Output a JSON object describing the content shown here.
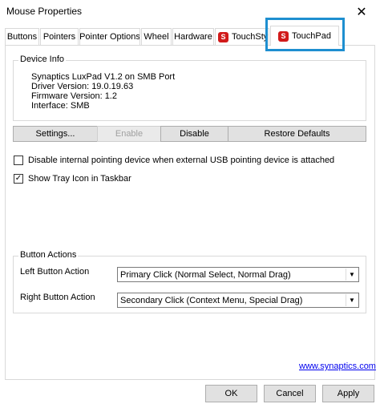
{
  "window": {
    "title": "Mouse Properties",
    "close_glyph": "✕"
  },
  "tabs": [
    {
      "label": "Buttons"
    },
    {
      "label": "Pointers"
    },
    {
      "label": "Pointer Options"
    },
    {
      "label": "Wheel"
    },
    {
      "label": "Hardware"
    },
    {
      "label": "TouchStyk"
    },
    {
      "label": "TouchPad",
      "active": true
    }
  ],
  "device_info": {
    "group_label": "Device Info",
    "lines": [
      "Synaptics LuxPad V1.2 on SMB Port",
      "Driver Version: 19.0.19.63",
      "Firmware Version: 1.2",
      "Interface: SMB"
    ]
  },
  "buttons": {
    "settings": "Settings...",
    "enable": "Enable",
    "disable": "Disable",
    "restore": "Restore Defaults"
  },
  "checkboxes": [
    {
      "label": "Disable internal pointing device when external USB pointing device is attached",
      "checked": false
    },
    {
      "label": "Show Tray Icon in Taskbar",
      "checked": true
    }
  ],
  "button_actions": {
    "group_label": "Button Actions",
    "left_label": "Left Button Action",
    "left_value": "Primary Click (Normal Select, Normal Drag)",
    "right_label": "Right Button Action",
    "right_value": "Secondary Click (Context Menu, Special Drag)"
  },
  "link": "www.synaptics.com",
  "footer": {
    "ok": "OK",
    "cancel": "Cancel",
    "apply": "Apply"
  },
  "colors": {
    "highlight": "#1e8fd0",
    "synaptics_red": "#d11a1a"
  }
}
